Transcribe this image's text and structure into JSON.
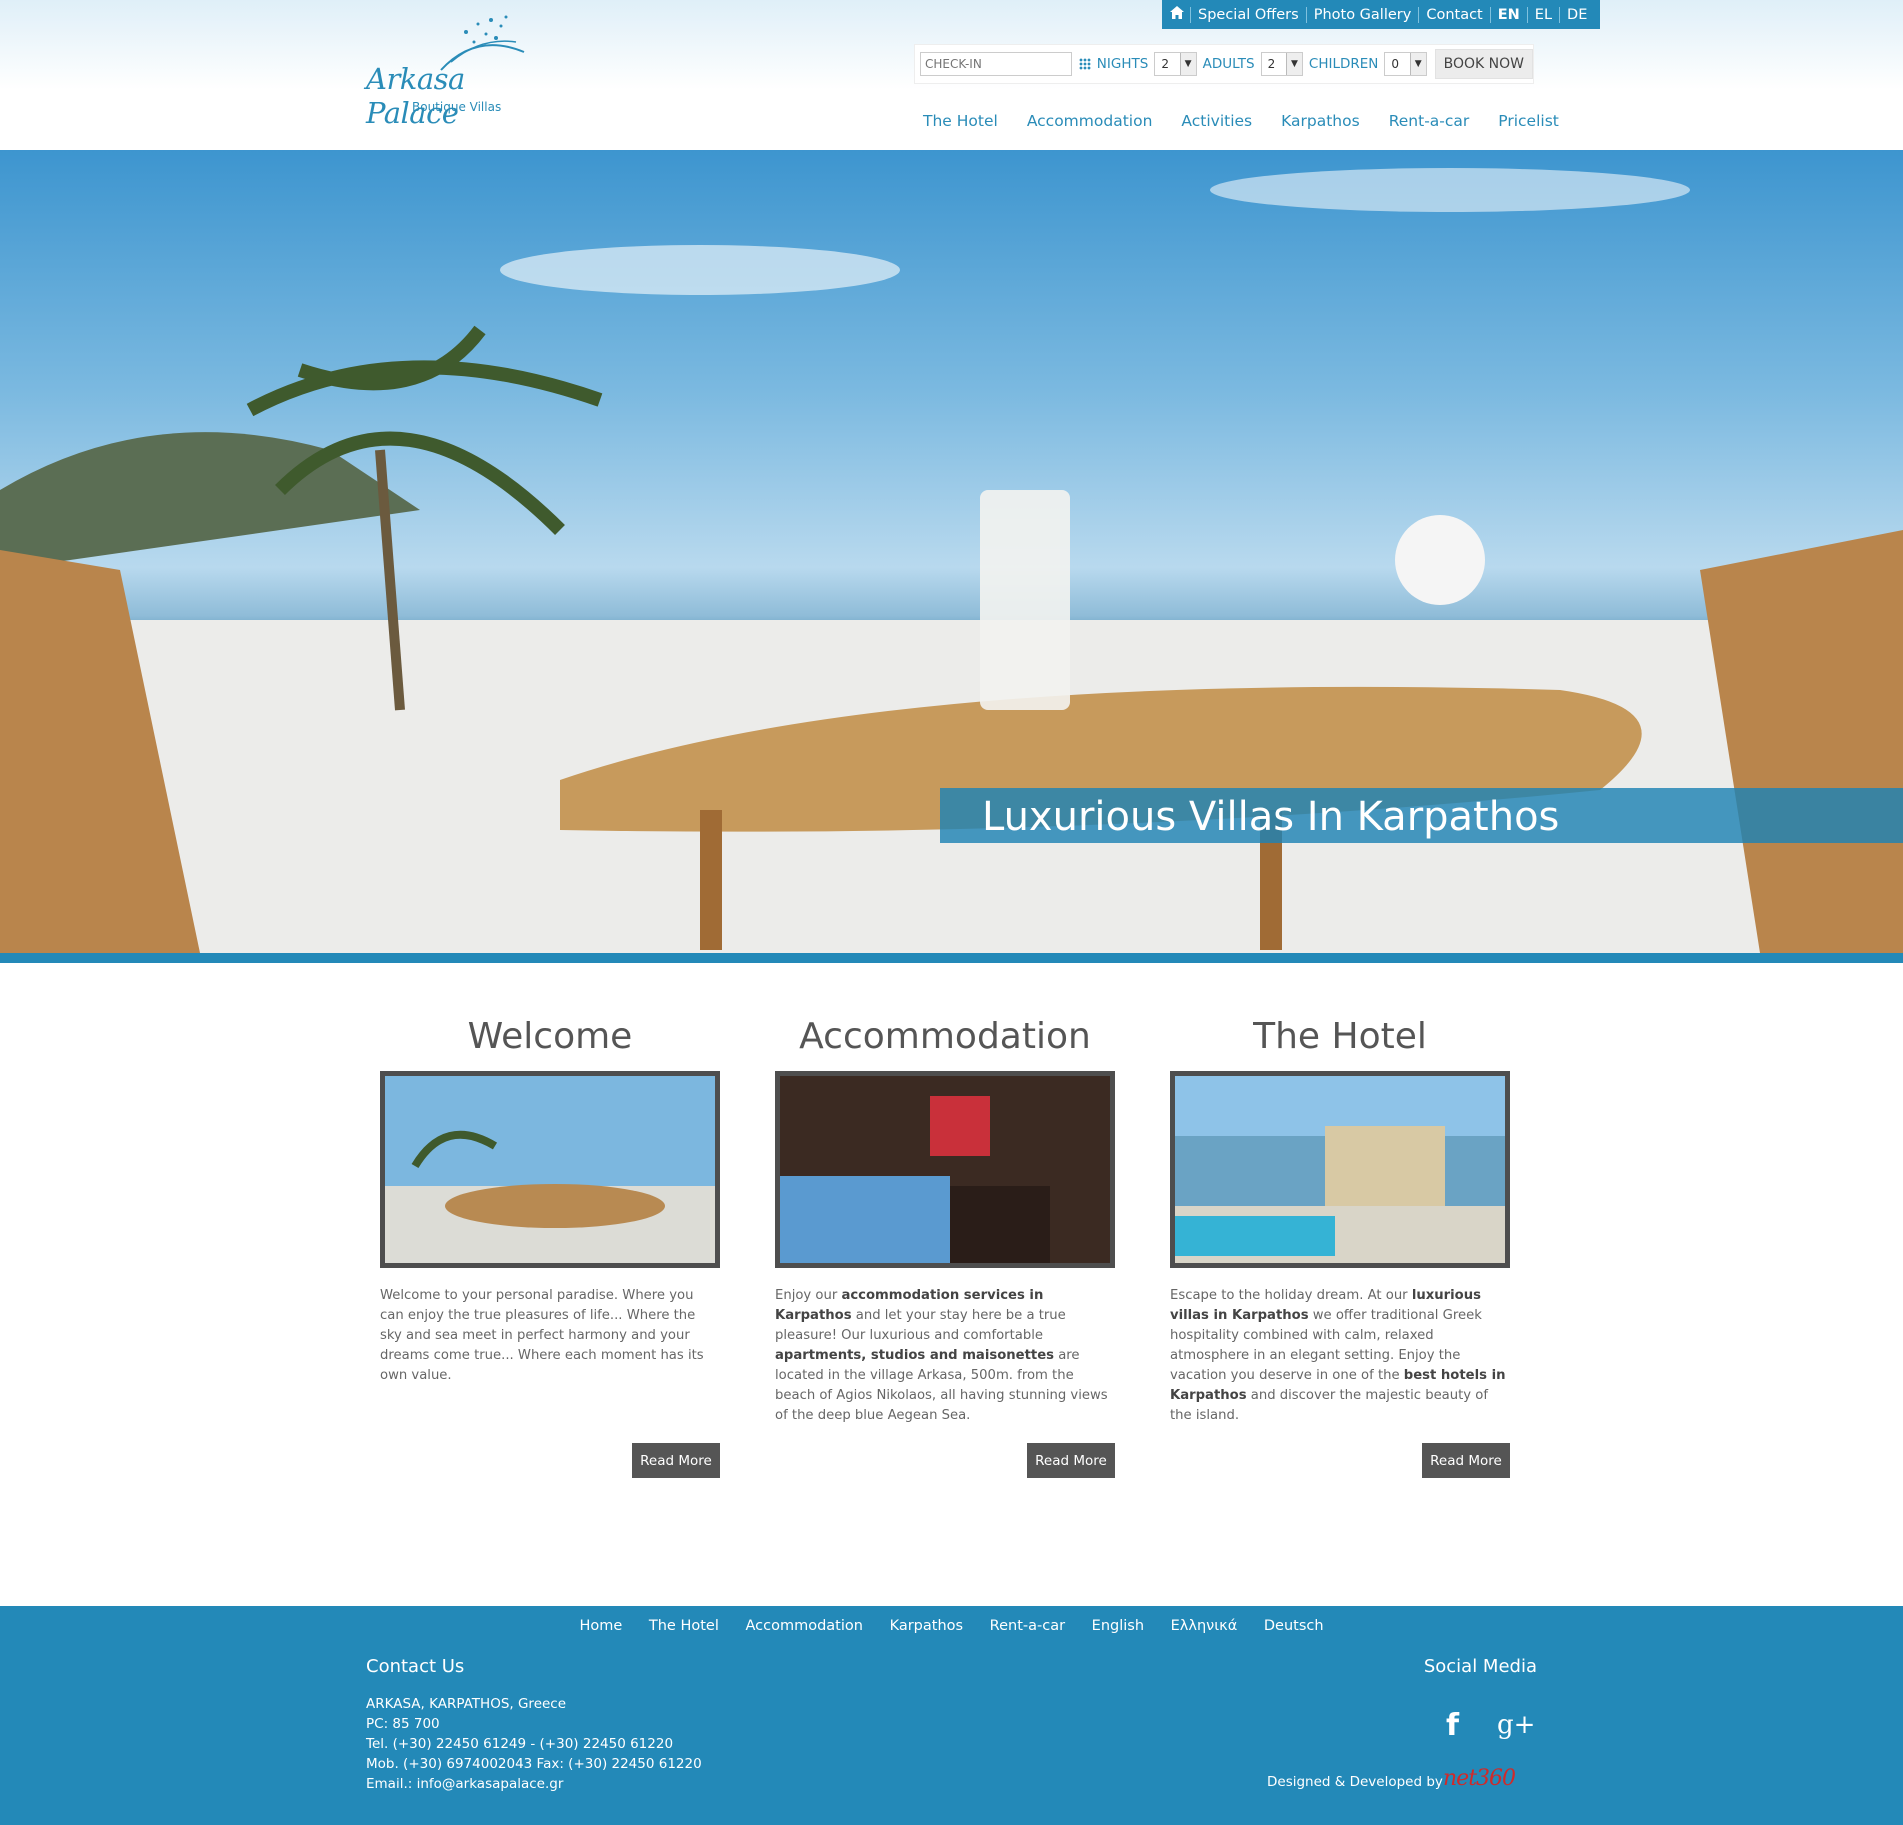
{
  "logo": {
    "name": "Arkasa Palace",
    "tagline": "Boutique Villas"
  },
  "topbar": {
    "home_icon": "home-icon",
    "links": [
      "Special Offers",
      "Photo Gallery",
      "Contact"
    ],
    "languages": [
      "EN",
      "EL",
      "DE"
    ],
    "active_language": "EN"
  },
  "booking": {
    "checkin_placeholder": "CHECK-IN",
    "calendar_icon": "calendar-icon",
    "nights_label": "NIGHTS",
    "nights_value": "2",
    "adults_label": "ADULTS",
    "adults_value": "2",
    "children_label": "CHILDREN",
    "children_value": "0",
    "book_label": "BOOK NOW"
  },
  "nav": [
    "The Hotel",
    "Accommodation",
    "Activities",
    "Karpathos",
    "Rent-a-car",
    "Pricelist"
  ],
  "hero": {
    "caption": "Luxurious Villas In Karpathos"
  },
  "columns": [
    {
      "title": "Welcome",
      "read_more": "Read More",
      "text": "Welcome to your personal paradise. Where you can enjoy the true pleasures of life... Where the sky and sea meet in perfect harmony and your dreams come true... Where each moment has its own value."
    },
    {
      "title": "Accommodation",
      "read_more": "Read More",
      "t1": "Enjoy our ",
      "b1": "accommodation services in Karpathos",
      "t2": " and let your stay here be a true pleasure! Our luxurious and comfortable ",
      "b2": "apartments, studios and maisonettes",
      "t3": " are located in the village Arkasa, 500m. from the beach of Agios Nikolaos, all having stunning views of the deep blue Aegean Sea."
    },
    {
      "title": "The Hotel",
      "read_more": "Read More",
      "t1": "Escape to the holiday dream. At our ",
      "b1": "luxurious villas in Karpathos",
      "t2": " we offer traditional Greek hospitality combined with calm, relaxed atmosphere in an elegant setting. Enjoy the vacation you deserve in one of the ",
      "b2": "best hotels in Karpathos",
      "t3": " and discover the majestic beauty of the island."
    }
  ],
  "footer": {
    "nav": [
      "Home",
      "The Hotel",
      "Accommodation",
      "Karpathos",
      "Rent-a-car",
      "English",
      "Ελληνικά",
      "Deutsch"
    ],
    "contact_title": "Contact Us",
    "contact_lines": [
      "ARKASA, KARPATHOS, Greece",
      "PC: 85 700",
      "Tel. (+30) 22450 61249 - (+30) 22450 61220",
      "Mob. (+30) 6974002043 Fax: (+30) 22450 61220",
      "Email.: info@arkasapalace.gr"
    ],
    "social_title": "Social Media",
    "social_icons": [
      "facebook-icon",
      "google-plus-icon"
    ],
    "credit": "Designed & Developed by",
    "credit_logo": "net360"
  },
  "colors": {
    "accent": "#2389b8",
    "text": "#555555",
    "button": "#555555"
  }
}
